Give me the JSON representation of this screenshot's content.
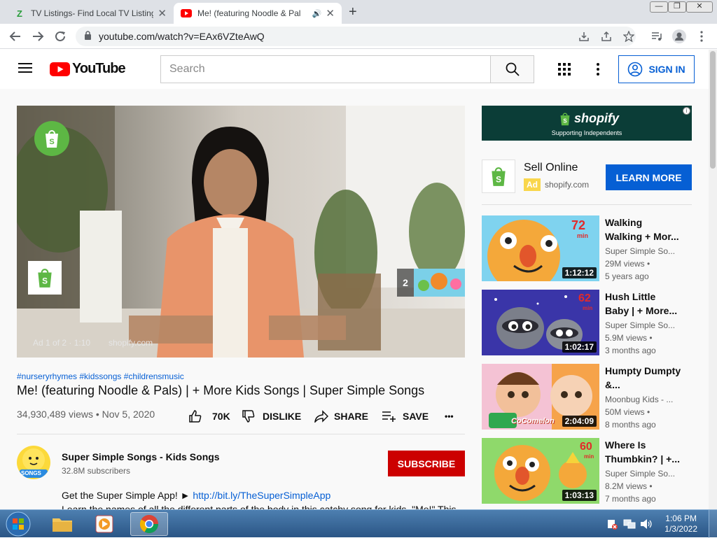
{
  "browser": {
    "tabs": [
      {
        "title": "TV Listings- Find Local TV Listing",
        "active": false,
        "favicon": "z-icon"
      },
      {
        "title": "Me! (featuring Noodle & Pal",
        "active": true,
        "favicon": "youtube-icon"
      }
    ],
    "url": "youtube.com/watch?v=EAx6VZteAwQ",
    "window_controls": [
      "—",
      "❐",
      "✕"
    ]
  },
  "youtube": {
    "logo_text": "YouTube",
    "search_placeholder": "Search",
    "signin_label": "SIGN IN"
  },
  "player": {
    "ad_counter": "Ad 1 of 2 · 1:10",
    "ad_domain": "shopify.com",
    "skip_count": "2"
  },
  "video": {
    "hashtags": "#nurseryrhymes #kidssongs #childrensmusic",
    "title": "Me! (featuring Noodle & Pals) | + More Kids Songs | Super Simple Songs",
    "views_date": "34,930,489 views • Nov 5, 2020",
    "like_count": "70K",
    "dislike_label": "DISLIKE",
    "share_label": "SHARE",
    "save_label": "SAVE",
    "more": "•••"
  },
  "channel": {
    "name": "Super Simple Songs - Kids Songs",
    "subscribers": "32.8M subscribers",
    "subscribe_label": "SUBSCRIBE",
    "avatar_text": "SONGS",
    "desc_line1": "Get the Super Simple App!  ► ",
    "desc_link": "http://bit.ly/TheSuperSimpleApp",
    "desc_line2": "Learn the names of all the different parts of the body in this catchy song for kids. \"Me!\" This"
  },
  "ad": {
    "banner_brand": "shopify",
    "banner_tagline": "Supporting Independents",
    "headline": "Sell Online",
    "badge": "Ad",
    "domain": "shopify.com",
    "cta": "LEARN MORE"
  },
  "recommendations": [
    {
      "title": "Walking Walking + Mor...",
      "channel": "Super Simple So...",
      "views": "29M views •",
      "age": "5 years ago",
      "duration": "1:12:12",
      "badge": "72",
      "badge_sub": "min"
    },
    {
      "title": "Hush Little Baby | + More...",
      "channel": "Super Simple So...",
      "views": "5.9M views •",
      "age": "3 months ago",
      "duration": "1:02:17",
      "badge": "62",
      "badge_sub": "min"
    },
    {
      "title": "Humpty Dumpty &...",
      "channel": "Moonbug Kids - ...",
      "views": "50M views •",
      "age": "8 months ago",
      "duration": "2:04:09",
      "thumb_text": "CoComelon"
    },
    {
      "title": "Where Is Thumbkin? | +...",
      "channel": "Super Simple So...",
      "views": "8.2M views •",
      "age": "7 months ago",
      "duration": "1:03:13",
      "badge": "60",
      "badge_sub": "min"
    }
  ],
  "taskbar": {
    "time": "1:06 PM",
    "date": "1/3/2022"
  }
}
